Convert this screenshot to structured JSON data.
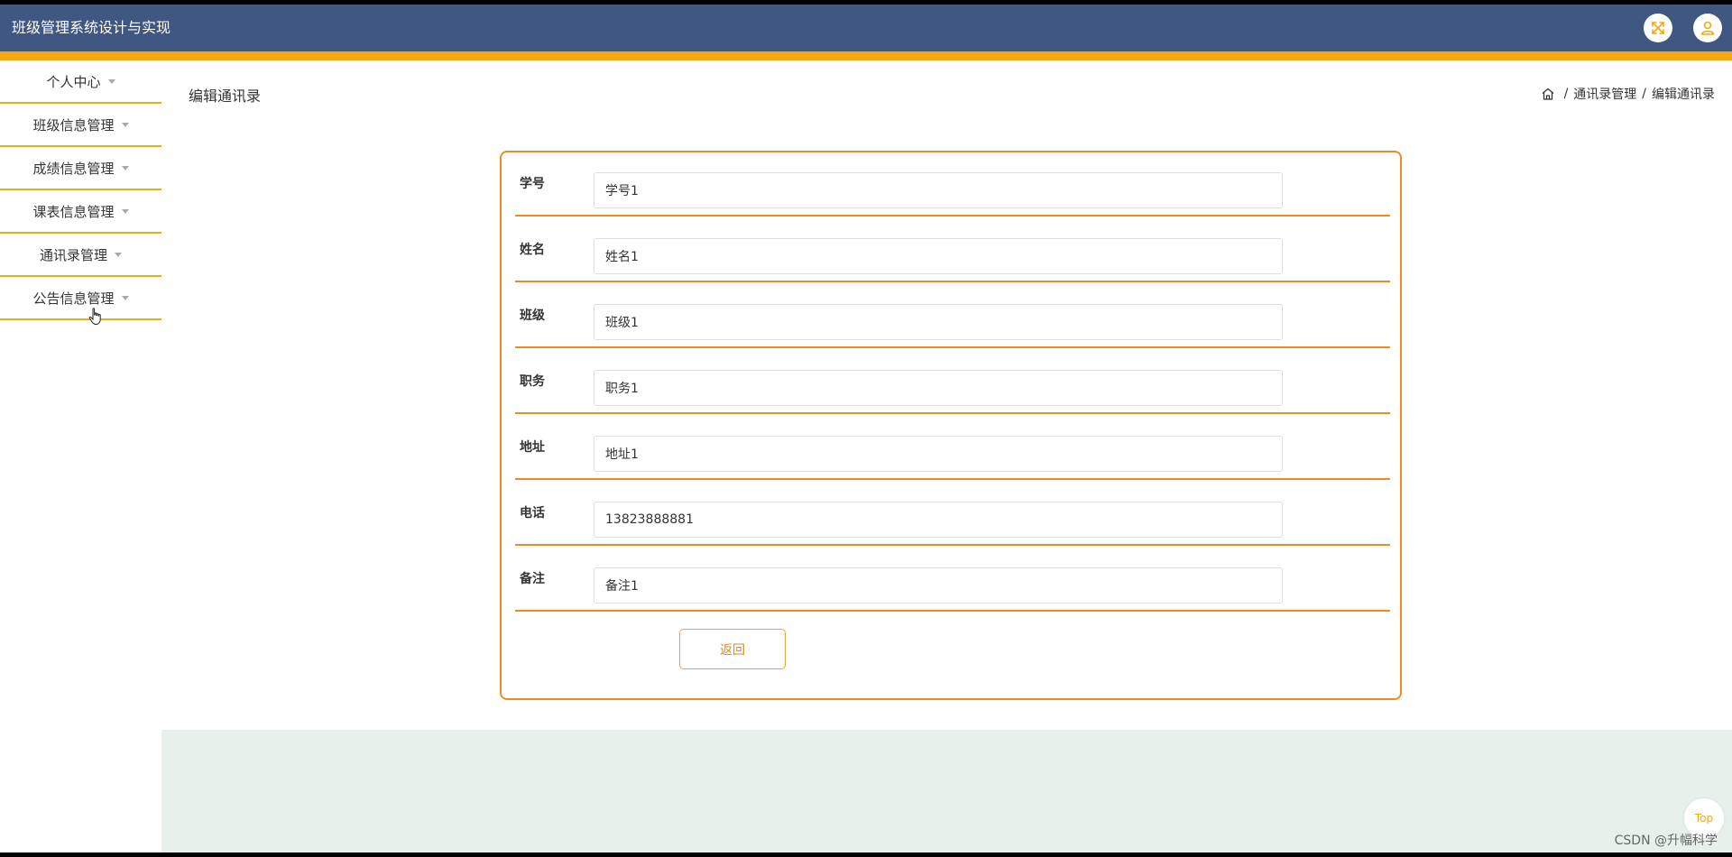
{
  "header": {
    "title": "班级管理系统设计与实现",
    "icons": [
      "fullscreen-icon",
      "user-icon"
    ]
  },
  "colors": {
    "header_bg": "#3f5781",
    "accent": "#f5a80f",
    "form_border": "#f08c1f",
    "bottom_bg": "#e7f0ea"
  },
  "sidebar": {
    "items": [
      {
        "label": "个人中心"
      },
      {
        "label": "班级信息管理"
      },
      {
        "label": "成绩信息管理"
      },
      {
        "label": "课表信息管理"
      },
      {
        "label": "通讯录管理"
      },
      {
        "label": "公告信息管理"
      }
    ]
  },
  "page": {
    "title": "编辑通讯录",
    "breadcrumb": [
      "通讯录管理",
      "编辑通讯录"
    ]
  },
  "form": {
    "fields": [
      {
        "label": "学号",
        "value": "学号1"
      },
      {
        "label": "姓名",
        "value": "姓名1"
      },
      {
        "label": "班级",
        "value": "班级1"
      },
      {
        "label": "职务",
        "value": "职务1"
      },
      {
        "label": "地址",
        "value": "地址1"
      },
      {
        "label": "电话",
        "value": "13823888881"
      },
      {
        "label": "备注",
        "value": "备注1"
      }
    ],
    "back_label": "返回"
  },
  "top_button": "Top",
  "watermark": "CSDN @升幅科学"
}
